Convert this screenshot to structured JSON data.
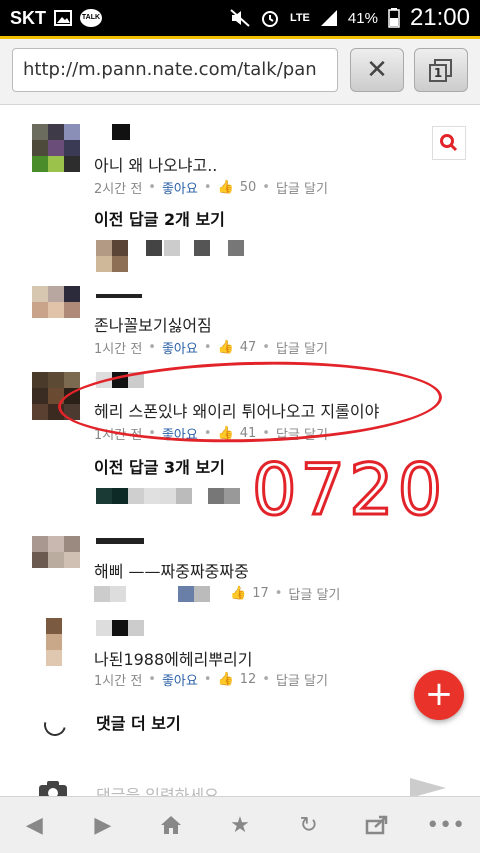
{
  "status_bar": {
    "carrier": "SKT",
    "talk": "TALK",
    "network": "LTE",
    "battery": "41%",
    "time": "21:00"
  },
  "browser": {
    "url": "http://m.pann.nate.com/talk/pan",
    "tab_count": "1"
  },
  "comments": [
    {
      "text": "아니 왜 나오냐고..",
      "time": "2시간 전",
      "like_label": "좋아요",
      "likes": "50",
      "reply_label": "답글 달기"
    },
    {
      "text": "존나꼴보기싫어짐",
      "time": "1시간 전",
      "like_label": "좋아요",
      "likes": "47",
      "reply_label": "답글 달기"
    },
    {
      "text": "헤리 스폰있냐 왜이리 튀어나오고 지롤이야",
      "time": "1시간 전",
      "like_label": "좋아요",
      "likes": "41",
      "reply_label": "답글 달기"
    },
    {
      "text": "해삐 ——짜중짜중짜중",
      "likes": "17",
      "reply_label": "답글 달기"
    },
    {
      "text": "나된1988에헤리뿌리기",
      "time": "1시간 전",
      "like_label": "좋아요",
      "likes": "12",
      "reply_label": "답글 달기"
    }
  ],
  "reply_toggles": [
    "이전 답글 2개 보기",
    "이전 답글 3개 보기"
  ],
  "annotation": "0720",
  "more_comments": "댓글 더 보기",
  "compose_placeholder": "댓글을 입력하세요",
  "colors": {
    "accent": "#f0c000",
    "highlight": "#e2242a",
    "fab": "#e8322a"
  }
}
